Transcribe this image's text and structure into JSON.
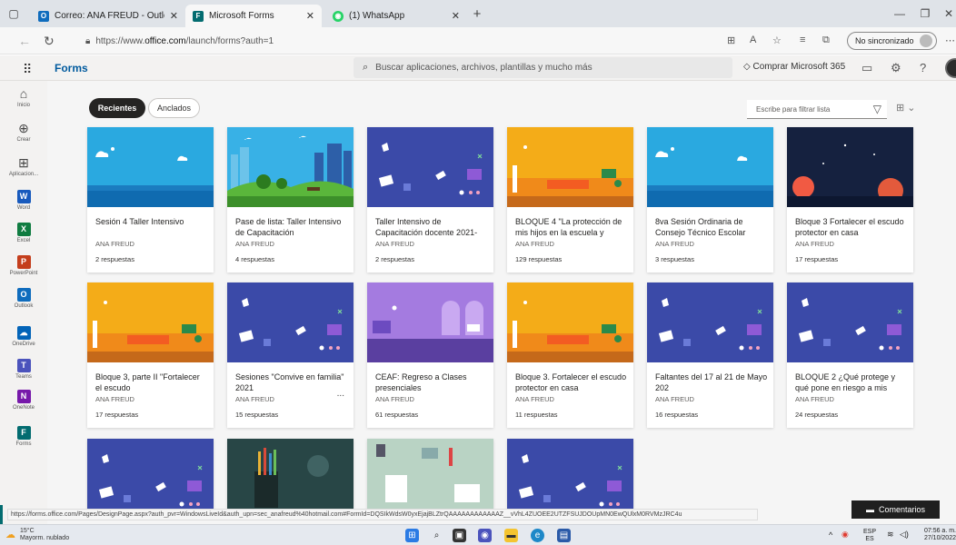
{
  "browser": {
    "tabs": [
      {
        "title": "Correo: ANA FREUD - Outlook",
        "icon": "outlook-icon",
        "color": "#0f6cbd",
        "active": false
      },
      {
        "title": "Microsoft Forms",
        "icon": "forms-icon",
        "color": "#036c70",
        "active": true
      },
      {
        "title": "(1) WhatsApp",
        "icon": "whatsapp-icon",
        "color": "#25d366",
        "active": false
      }
    ],
    "new_tab": "+",
    "url_prefix": "https://www.",
    "url_domain": "office.com",
    "url_path": "/launch/forms?auth=1",
    "sync_label": "No sincronizado"
  },
  "appbar": {
    "app_name": "Forms",
    "search_placeholder": "Buscar aplicaciones, archivos, plantillas y mucho más",
    "buy_label": "Comprar Microsoft 365"
  },
  "rail": [
    {
      "label": "Inicio",
      "glyph": "⌂",
      "icon": "home-icon"
    },
    {
      "label": "Crear",
      "glyph": "⊕",
      "icon": "create-icon"
    },
    {
      "label": "Aplicacion...",
      "glyph": "⊞",
      "icon": "apps-icon"
    },
    {
      "label": "Word",
      "glyph": "W",
      "icon": "word-icon",
      "color": "#185abd"
    },
    {
      "label": "Excel",
      "glyph": "X",
      "icon": "excel-icon",
      "color": "#107c41"
    },
    {
      "label": "PowerPoint",
      "glyph": "P",
      "icon": "powerpoint-icon",
      "color": "#c43e1c"
    },
    {
      "label": "Outlook",
      "glyph": "O",
      "icon": "outlook-icon",
      "color": "#0f6cbd"
    },
    {
      "label": "OneDrive",
      "glyph": "☁",
      "icon": "onedrive-icon",
      "color": "#0364b8"
    },
    {
      "label": "Teams",
      "glyph": "T",
      "icon": "teams-icon",
      "color": "#4b53bc"
    },
    {
      "label": "OneNote",
      "glyph": "N",
      "icon": "onenote-icon",
      "color": "#7719aa"
    },
    {
      "label": "Forms",
      "glyph": "F",
      "icon": "forms-icon",
      "color": "#036c70"
    }
  ],
  "main": {
    "pill_recent": "Recientes",
    "pill_pinned": "Anclados",
    "filter_placeholder": "Escribe para filtrar lista"
  },
  "cards": [
    {
      "title": "Sesión 4 Taller Intensivo",
      "owner": "ANA FREUD",
      "responses": "2 respuestas",
      "banner": "sky"
    },
    {
      "title": "Pase de lista: Taller Intensivo de Capacitación",
      "owner": "ANA FREUD",
      "responses": "4 respuestas",
      "banner": "city"
    },
    {
      "title": "Taller Intensivo de Capacitación docente 2021-",
      "owner": "ANA FREUD",
      "responses": "2 respuestas",
      "banner": "purple"
    },
    {
      "title": "BLOQUE 4 \"La protección de mis hijos en la escuela y",
      "owner": "ANA FREUD",
      "responses": "129 respuestas",
      "banner": "orange"
    },
    {
      "title": "8va Sesión Ordinaria de Consejo Técnico Escolar",
      "owner": "ANA FREUD",
      "responses": "3 respuestas",
      "banner": "sky"
    },
    {
      "title": "Bloque 3 Fortalecer el escudo protector en casa",
      "owner": "ANA FREUD",
      "responses": "17 respuestas",
      "banner": "space"
    },
    {
      "title": "Bloque 3, parte II \"Fortalecer el escudo",
      "owner": "ANA FREUD",
      "responses": "17 respuestas",
      "banner": "orange"
    },
    {
      "title": "Sesiones \"Convive en familia\" 2021",
      "owner": "ANA FREUD",
      "responses": "15 respuestas",
      "banner": "purple",
      "more": "..."
    },
    {
      "title": "CEAF: Regreso a Clases presenciales",
      "owner": "ANA FREUD",
      "responses": "61 respuestas",
      "banner": "lilac"
    },
    {
      "title": "Bloque 3. Fortalecer el escudo protector en casa",
      "owner": "ANA FREUD",
      "responses": "11 respuestas",
      "banner": "orange"
    },
    {
      "title": "Faltantes del 17 al 21 de Mayo 202",
      "owner": "ANA FREUD",
      "responses": "16 respuestas",
      "banner": "purple"
    },
    {
      "title": "BLOQUE 2 ¿Qué protege y qué pone en riesgo a mis",
      "owner": "ANA FREUD",
      "responses": "24 respuestas",
      "banner": "purple"
    },
    {
      "banner": "purple"
    },
    {
      "banner": "pencils"
    },
    {
      "banner": "desk"
    },
    {
      "banner": "purple"
    }
  ],
  "status_url": "https://forms.office.com/Pages/DesignPage.aspx?auth_pvr=WindowsLiveId&auth_upn=sec_anafreud%40hotmail.com#FormId=DQSIkWdsW0yxEjajBLZtrQAAAAAAAAAAAAZ__vVhL4ZUOEE2UTZFSUJDOUpMN0EwQUlxM0RVMzJRC4u",
  "feedback_label": "Comentarios",
  "taskbar": {
    "temp": "15°C",
    "weather": "Mayorm. nublado",
    "lang": "ESP",
    "lang2": "ES",
    "time": "07:56 a. m.",
    "date": "27/10/2022"
  }
}
